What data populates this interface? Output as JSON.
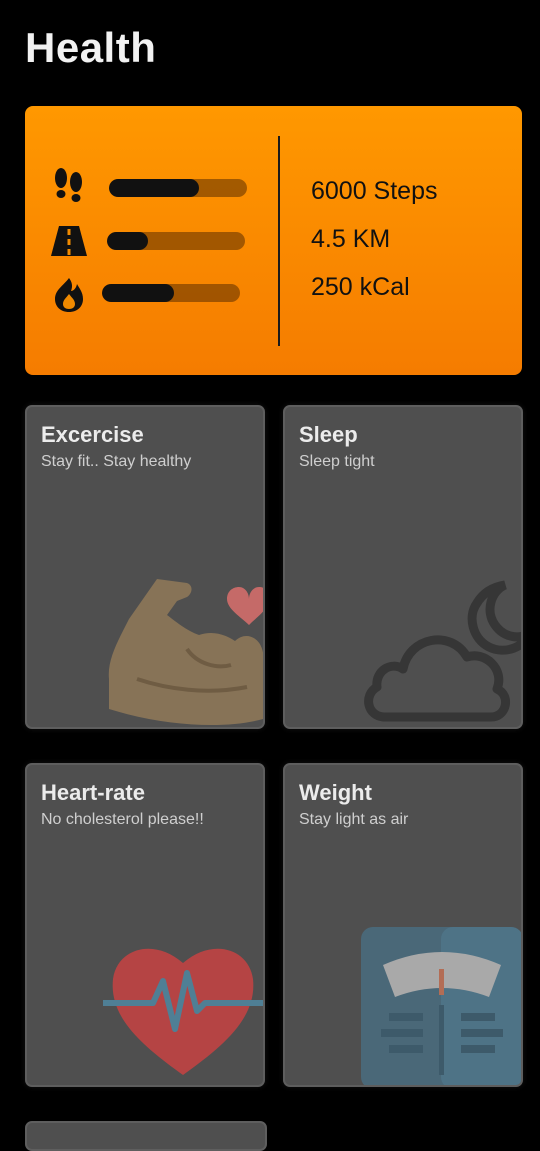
{
  "header": {
    "title": "Health"
  },
  "summary": {
    "stats": [
      {
        "icon": "footprints-icon",
        "value": "6000 Steps",
        "progress": 0.65
      },
      {
        "icon": "road-icon",
        "value": "4.5 KM",
        "progress": 0.3
      },
      {
        "icon": "fire-icon",
        "value": "250 kCal",
        "progress": 0.52
      }
    ]
  },
  "cards": [
    {
      "title": "Excercise",
      "subtitle": "Stay fit.. Stay healthy",
      "icon": "muscle-arm-icon"
    },
    {
      "title": "Sleep",
      "subtitle": "Sleep tight",
      "icon": "cloud-moon-icon"
    },
    {
      "title": "Heart-rate",
      "subtitle": "No cholesterol please!!",
      "icon": "heart-pulse-icon"
    },
    {
      "title": "Weight",
      "subtitle": "Stay light as air",
      "icon": "weighing-scale-icon"
    }
  ],
  "colors": {
    "background": "#000000",
    "summary_gradient_top": "#ff9800",
    "summary_gradient_bottom": "#f57c00",
    "card": "#4f4f4f"
  }
}
